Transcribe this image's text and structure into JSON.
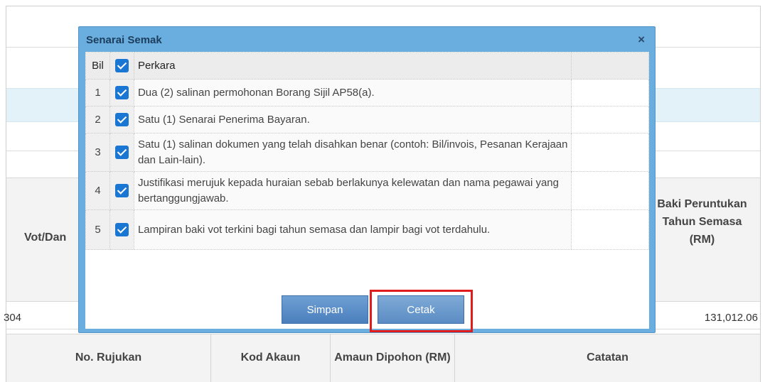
{
  "background": {
    "vot_label": "Vot/Dan",
    "baki_label": "Baki Peruntukan Tahun Semasa (RM)",
    "row_code": "304",
    "row_amount": "131,012.06",
    "bottom_headers": [
      "No. Rujukan",
      "Kod Akaun",
      "Amaun Dipohon (RM)",
      "Catatan"
    ]
  },
  "modal": {
    "title": "Senarai Semak",
    "close_symbol": "×",
    "columns": {
      "bil": "Bil",
      "perkara": "Perkara"
    },
    "header_checked": true,
    "items": [
      {
        "bil": "1",
        "checked": true,
        "text": "Dua (2) salinan permohonan Borang Sijil AP58(a)."
      },
      {
        "bil": "2",
        "checked": true,
        "text": "Satu (1) Senarai Penerima Bayaran."
      },
      {
        "bil": "3",
        "checked": true,
        "text": "Satu (1) salinan dokumen yang telah disahkan benar (contoh: Bil/invois, Pesanan Kerajaan dan Lain-lain)."
      },
      {
        "bil": "4",
        "checked": true,
        "text": "Justifikasi merujuk kepada huraian sebab berlakunya kelewatan dan nama pegawai yang bertanggungjawab."
      },
      {
        "bil": "5",
        "checked": true,
        "text": "Lampiran baki vot terkini bagi tahun semasa dan lampir bagi vot terdahulu."
      }
    ],
    "buttons": {
      "simpan": "Simpan",
      "cetak": "Cetak"
    }
  },
  "colors": {
    "modal_frame": "#6aaee0",
    "checkbox": "#1976d2",
    "button": "#4a7fbd",
    "highlight": "#e01b1b"
  }
}
